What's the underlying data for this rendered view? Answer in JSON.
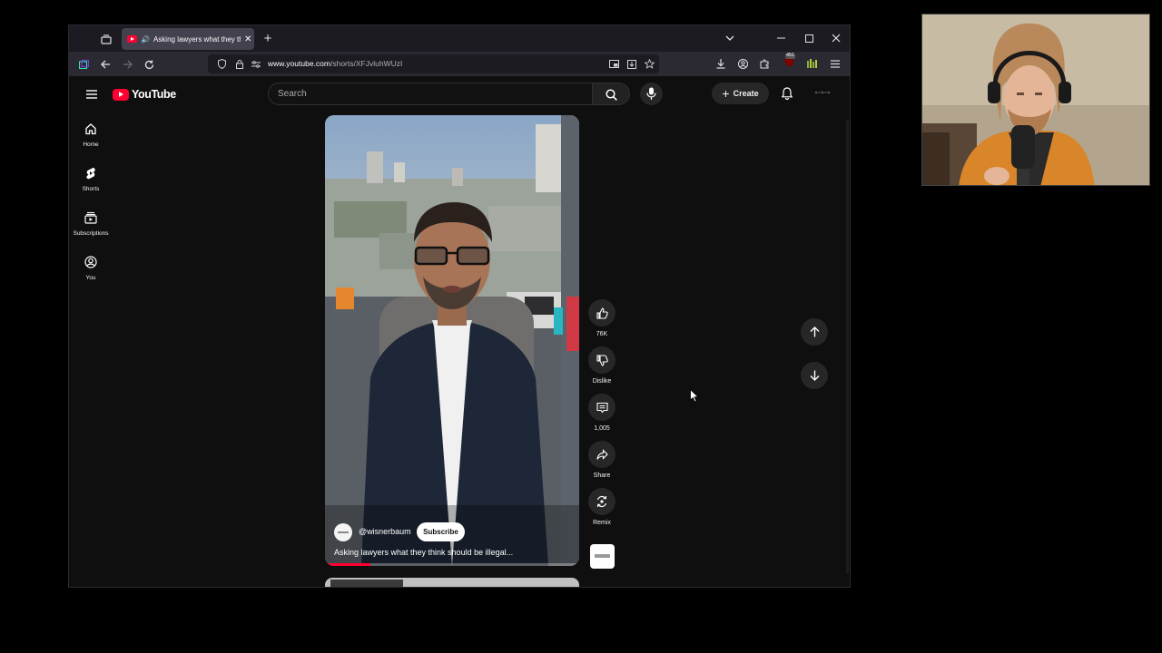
{
  "browser": {
    "tab_title": "Asking lawyers what they th",
    "url_domain": "www.youtube.com",
    "url_path": "/shorts/XFJvluhWUzI",
    "extension_badge": "451"
  },
  "youtube": {
    "logo_text": "YouTube",
    "search_placeholder": "Search",
    "create_label": "Create",
    "sidebar": [
      {
        "label": "Home",
        "icon": "home-icon"
      },
      {
        "label": "Shorts",
        "icon": "shorts-icon"
      },
      {
        "label": "Subscriptions",
        "icon": "subscriptions-icon"
      },
      {
        "label": "You",
        "icon": "you-icon"
      }
    ],
    "short": {
      "channel": "@wisnerbaum",
      "subscribe_label": "Subscribe",
      "title": "Asking lawyers what they think should be illegal...",
      "progress_fraction": 0.18
    },
    "actions": {
      "likes": "76K",
      "dislike": "Dislike",
      "comments": "1,005",
      "share": "Share",
      "remix": "Remix"
    },
    "colors": {
      "brand_red": "#ff0033",
      "page_bg": "#0f0f0f",
      "button_bg": "#272727"
    }
  }
}
